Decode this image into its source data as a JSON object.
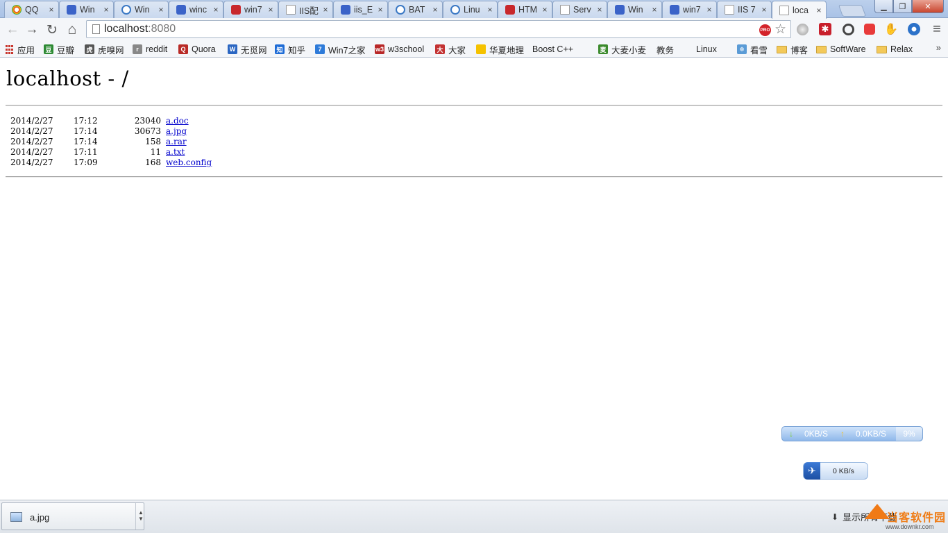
{
  "browser": {
    "tabs": [
      {
        "title": "QQ",
        "icon": "qq-icon",
        "kind": "qq"
      },
      {
        "title": "Win",
        "icon": "baidu-paw-icon",
        "kind": "baidu"
      },
      {
        "title": "Win",
        "icon": "globe-icon",
        "kind": "globe"
      },
      {
        "title": "winc",
        "icon": "baidu-paw-icon",
        "kind": "baidu"
      },
      {
        "title": "win7",
        "icon": "red-b-icon",
        "kind": "red"
      },
      {
        "title": "IIS配",
        "icon": "page-icon",
        "kind": "doc"
      },
      {
        "title": "iis_E",
        "icon": "baidu-paw-icon",
        "kind": "baidu"
      },
      {
        "title": "BAT",
        "icon": "globe-icon",
        "kind": "globe"
      },
      {
        "title": "Linu",
        "icon": "globe-icon",
        "kind": "globe"
      },
      {
        "title": "HTM",
        "icon": "w3-icon",
        "kind": "red"
      },
      {
        "title": "Serv",
        "icon": "page-icon",
        "kind": "doc"
      },
      {
        "title": "Win",
        "icon": "baidu-paw-icon",
        "kind": "baidu"
      },
      {
        "title": "win7",
        "icon": "baidu-paw-icon",
        "kind": "baidu"
      },
      {
        "title": "IIS 7",
        "icon": "page-icon",
        "kind": "doc"
      },
      {
        "title": "loca",
        "icon": "page-icon",
        "kind": "doc",
        "active": true
      }
    ],
    "tab_close_glyph": "×",
    "window_buttons": {
      "minimize": "▁",
      "maximize": "❐",
      "close": "✕"
    }
  },
  "toolbar": {
    "back": "←",
    "forward": "→",
    "reload": "↻",
    "home": "⌂",
    "address_host": "localhost",
    "address_port": ":8080",
    "pro_badge": "PRO",
    "star": "☆",
    "menu": "≡"
  },
  "bookmarks": [
    {
      "label": "应用",
      "icon": "apps-grid-icon",
      "kind": "grid",
      "color": "#c8362e"
    },
    {
      "label": "豆瓣",
      "icon": "douban-icon",
      "kind": "solid",
      "color": "#2d8a34",
      "glyph": "豆"
    },
    {
      "label": "虎嗅网",
      "icon": "huxiu-icon",
      "kind": "solid",
      "color": "#555555",
      "glyph": "虎"
    },
    {
      "label": "reddit",
      "icon": "reddit-icon",
      "kind": "solid",
      "color": "#888888",
      "glyph": "r"
    },
    {
      "label": "Quora",
      "icon": "quora-icon",
      "kind": "solid",
      "color": "#b92b27",
      "glyph": "Q"
    },
    {
      "label": "无觅网",
      "icon": "wumi-icon",
      "kind": "solid",
      "color": "#2a66c2",
      "glyph": "W"
    },
    {
      "label": "知乎",
      "icon": "zhihu-icon",
      "kind": "solid",
      "color": "#1e6cd6",
      "glyph": "知"
    },
    {
      "label": "Win7之家",
      "icon": "win7home-icon",
      "kind": "solid",
      "color": "#2e7bd9",
      "glyph": "7"
    },
    {
      "label": "w3school",
      "icon": "w3school-icon",
      "kind": "solid",
      "color": "#b82828",
      "glyph": "w3"
    },
    {
      "label": "大家",
      "icon": "dajia-icon",
      "kind": "solid",
      "color": "#c33232",
      "glyph": "大"
    },
    {
      "label": "华夏地理",
      "icon": "natgeo-icon",
      "kind": "solid",
      "color": "#f5c200",
      "glyph": ""
    },
    {
      "label": "Boost C++",
      "icon": "page-icon",
      "kind": "page"
    },
    {
      "label": "大麦小麦",
      "icon": "damai-icon",
      "kind": "solid",
      "color": "#3b8a2c",
      "glyph": "麦"
    },
    {
      "label": "教务",
      "icon": "page-icon",
      "kind": "page"
    },
    {
      "label": "Linux",
      "icon": "page-icon",
      "kind": "page"
    },
    {
      "label": "看雪",
      "icon": "snowflake-icon",
      "kind": "solid",
      "color": "#5a9bd6",
      "glyph": "❄"
    },
    {
      "label": "博客",
      "icon": "folder-icon",
      "kind": "folder"
    },
    {
      "label": "SoftWare",
      "icon": "folder-icon",
      "kind": "folder"
    },
    {
      "label": "Relax",
      "icon": "folder-icon",
      "kind": "folder"
    }
  ],
  "bookmarks_more": "»",
  "page": {
    "title": "localhost - /",
    "files": [
      {
        "date": "2014/2/27",
        "time": "17:12",
        "size": "23040",
        "name": "a.doc"
      },
      {
        "date": "2014/2/27",
        "time": "17:14",
        "size": "30673",
        "name": "a.jpg"
      },
      {
        "date": "2014/2/27",
        "time": "17:14",
        "size": "158",
        "name": "a.rar"
      },
      {
        "date": "2014/2/27",
        "time": "17:11",
        "size": "11",
        "name": "a.txt"
      },
      {
        "date": "2014/2/27",
        "time": "17:09",
        "size": "168",
        "name": "web.config"
      }
    ]
  },
  "netspeed": {
    "down": "0KB/S",
    "up": "0.0KB/S",
    "percent": "9%"
  },
  "thunder": {
    "speed": "0 KB/s"
  },
  "downloads": {
    "item_name": "a.jpg",
    "show_all": "显示所有下载",
    "watermark_title": "当客软件园",
    "watermark_url": "www.downkr.com"
  }
}
